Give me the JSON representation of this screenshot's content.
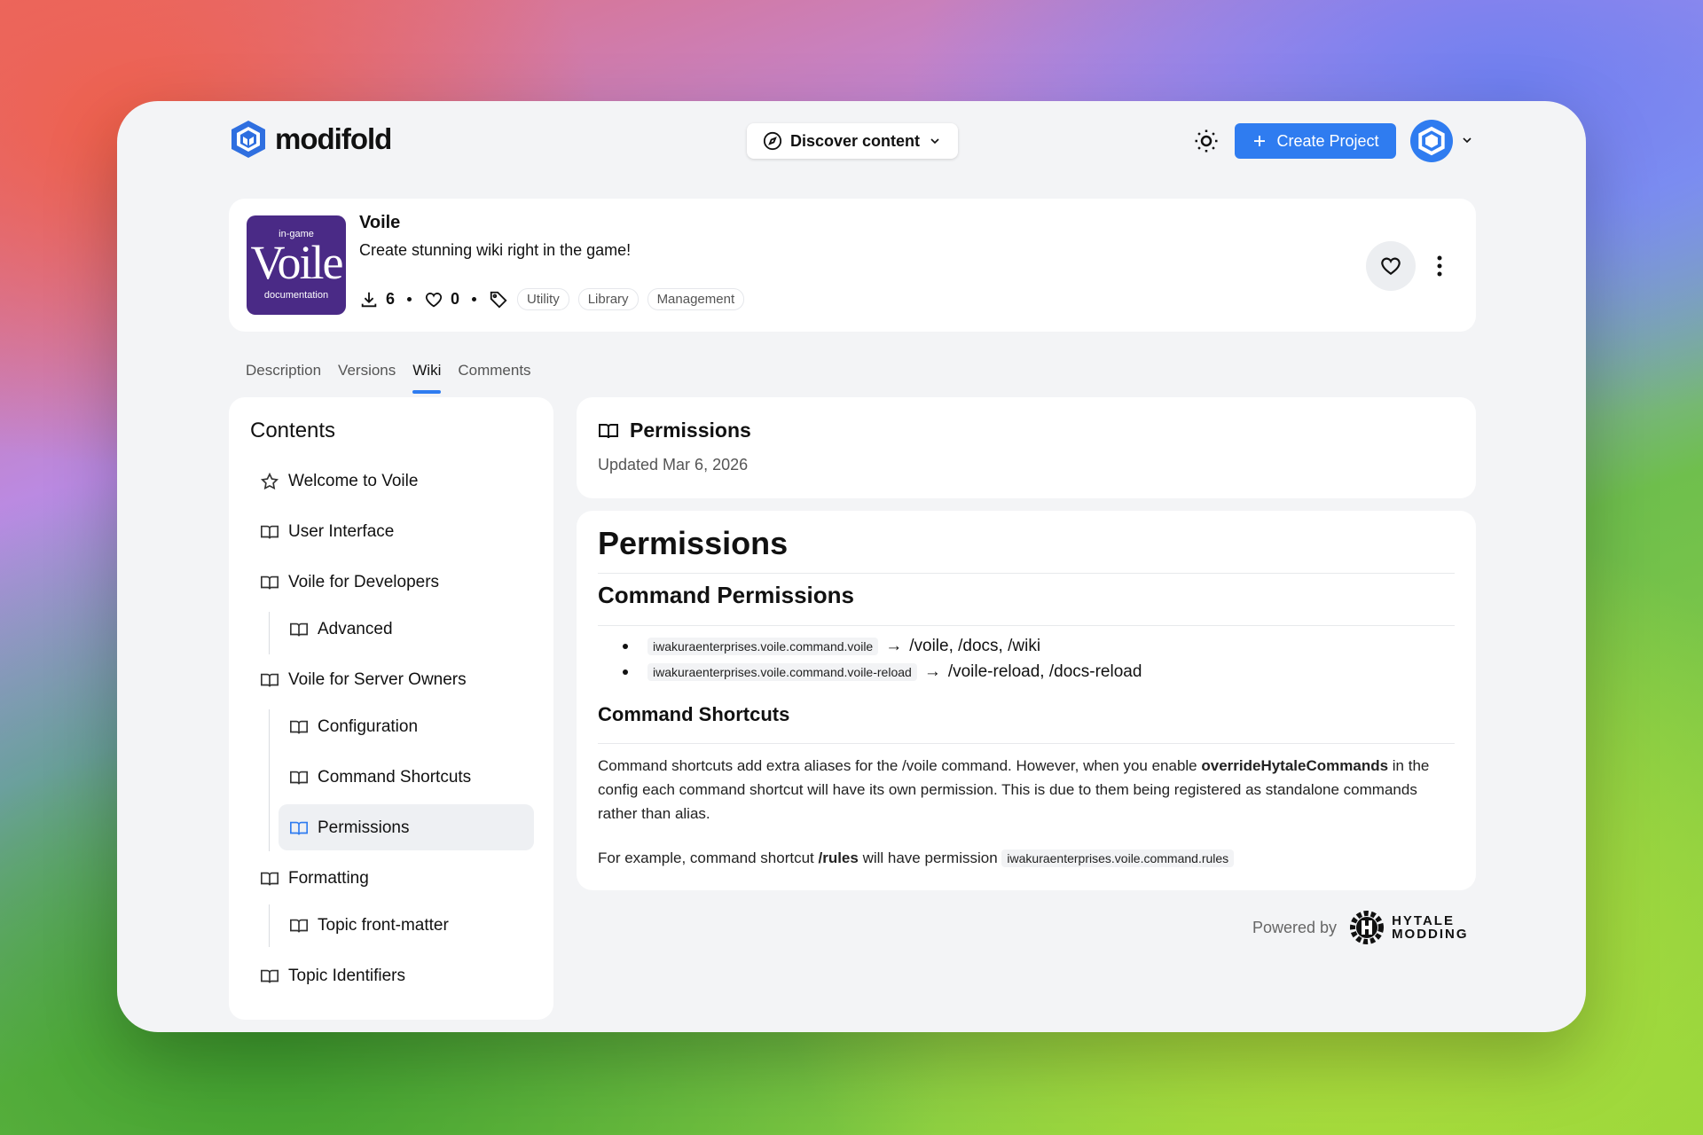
{
  "header": {
    "brand": "modifold",
    "discover": "Discover content",
    "create": "Create Project"
  },
  "project": {
    "thumb_top": "in-game",
    "thumb_main": "Voile",
    "thumb_bottom": "documentation",
    "title": "Voile",
    "subtitle": "Create stunning wiki right in the game!",
    "downloads": "6",
    "likes": "0",
    "tags": [
      "Utility",
      "Library",
      "Management"
    ]
  },
  "tabs": [
    "Description",
    "Versions",
    "Wiki",
    "Comments"
  ],
  "sidebar": {
    "heading": "Contents",
    "items": [
      "Welcome to Voile",
      "User Interface",
      "Voile for Developers",
      "Advanced",
      "Voile for Server Owners",
      "Configuration",
      "Command Shortcuts",
      "Permissions",
      "Formatting",
      "Topic front-matter",
      "Topic Identifiers"
    ]
  },
  "page": {
    "title": "Permissions",
    "updated": "Updated Mar 6, 2026"
  },
  "content": {
    "h1": "Permissions",
    "h2": "Command Permissions",
    "perms": [
      {
        "code": "iwakuraenterprises.voile.command.voile",
        "arrow": "→",
        "text": "/voile, /docs, /wiki"
      },
      {
        "code": "iwakuraenterprises.voile.command.voile-reload",
        "arrow": "→",
        "text": "/voile-reload, /docs-reload"
      }
    ],
    "h3": "Command Shortcuts",
    "p1a": "Command shortcuts add extra aliases for the /voile command. However, when you enable ",
    "p1b": "overrideHytaleCommands",
    "p1c": " in the config each command shortcut will have its own permission. This is due to them being registered as standalone commands rather than alias.",
    "p2a": "For example, command shortcut ",
    "p2b": "/rules",
    "p2c": " will have permission ",
    "p2code": "iwakuraenterprises.voile.command.rules"
  },
  "footer": {
    "powered": "Powered by",
    "brand1": "HYTALE",
    "brand2": "MODDING"
  },
  "colors": {
    "accent": "#2f7cf0",
    "thumb": "#4a2a86"
  }
}
